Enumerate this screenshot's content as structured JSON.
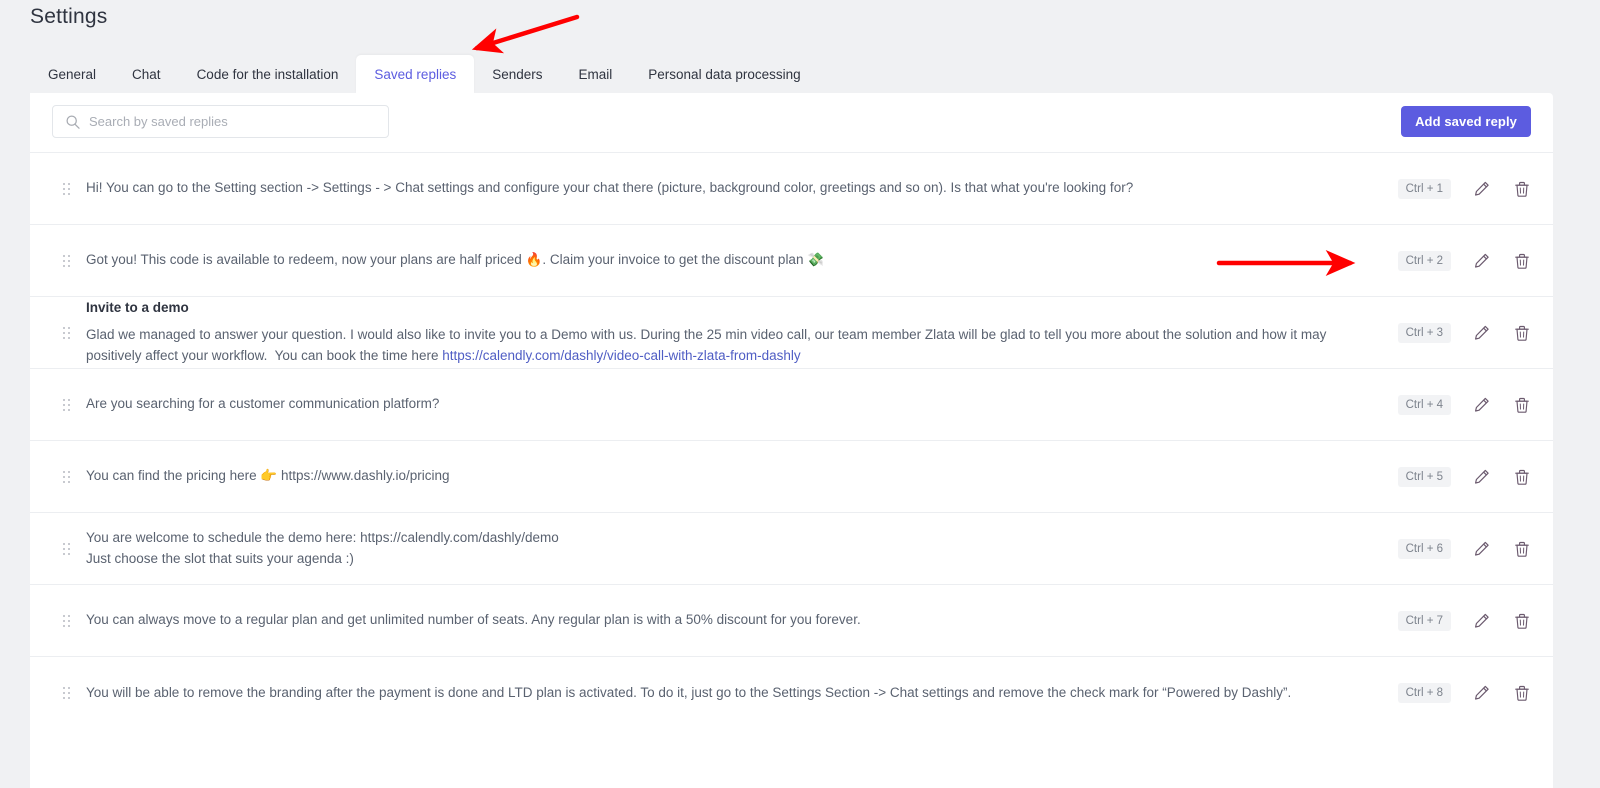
{
  "page": {
    "title": "Settings"
  },
  "tabs": [
    {
      "label": "General",
      "active": false
    },
    {
      "label": "Chat",
      "active": false
    },
    {
      "label": "Code for the installation",
      "active": false
    },
    {
      "label": "Saved replies",
      "active": true
    },
    {
      "label": "Senders",
      "active": false
    },
    {
      "label": "Email",
      "active": false
    },
    {
      "label": "Personal data processing",
      "active": false
    }
  ],
  "toolbar": {
    "search_placeholder": "Search by saved replies",
    "search_value": "",
    "search_icon": "search-icon",
    "add_button_label": "Add saved reply"
  },
  "rows": [
    {
      "heading": "",
      "text": "Hi! You can go to the Setting section -> Settings - > Chat settings and configure your chat there (picture, background color, greetings and so on). Is that what you're looking for?",
      "shortcut": "Ctrl + 1",
      "edit_icon": "pencil-icon",
      "delete_icon": "trash-icon",
      "drag_icon": "drag-handle-icon"
    },
    {
      "heading": "",
      "text": "Got you! This code is available to redeem, now your plans are half priced 🔥. Claim your invoice to get the discount plan 💸",
      "shortcut": "Ctrl + 2",
      "edit_icon": "pencil-icon",
      "delete_icon": "trash-icon",
      "drag_icon": "drag-handle-icon"
    },
    {
      "heading": "Invite to a demo",
      "text": "Glad we managed to answer your question. I would also like to invite you to a Demo with us. During the 25 min video call, our team member Zlata will be glad to tell you more about the solution and how it may positively affect your workflow.  You can book the time here https://calendly.com/dashly/video-call-with-zlata-from-dashly",
      "link": "https://calendly.com/dashly/video-call-with-zlata-from-dashly",
      "shortcut": "Ctrl + 3",
      "edit_icon": "pencil-icon",
      "delete_icon": "trash-icon",
      "drag_icon": "drag-handle-icon"
    },
    {
      "heading": "",
      "text": "Are you searching for a customer communication platform?",
      "shortcut": "Ctrl + 4",
      "edit_icon": "pencil-icon",
      "delete_icon": "trash-icon",
      "drag_icon": "drag-handle-icon"
    },
    {
      "heading": "",
      "text": "You can find the pricing here 👉 https://www.dashly.io/pricing",
      "shortcut": "Ctrl + 5",
      "edit_icon": "pencil-icon",
      "delete_icon": "trash-icon",
      "drag_icon": "drag-handle-icon"
    },
    {
      "heading": "",
      "text": "You are welcome to schedule the demo here: https://calendly.com/dashly/demo\nJust choose the slot that suits your agenda :)",
      "shortcut": "Ctrl + 6",
      "edit_icon": "pencil-icon",
      "delete_icon": "trash-icon",
      "drag_icon": "drag-handle-icon"
    },
    {
      "heading": "",
      "text": "You can always move to a regular plan and get unlimited number of seats. Any regular plan is with a 50% discount for you forever.",
      "shortcut": "Ctrl + 7",
      "edit_icon": "pencil-icon",
      "delete_icon": "trash-icon",
      "drag_icon": "drag-handle-icon"
    },
    {
      "heading": "",
      "text": "You will be able to remove the branding after the payment is done and LTD plan is activated. To do it, just go to the Settings Section -> Chat settings and remove the check mark for “Powered by Dashly”.",
      "shortcut": "Ctrl + 8",
      "edit_icon": "pencil-icon",
      "delete_icon": "trash-icon",
      "drag_icon": "drag-handle-icon"
    }
  ],
  "annotations": [
    {
      "name": "arrow-to-saved-replies-tab",
      "color": "#ff0000"
    },
    {
      "name": "arrow-to-ctrl-2-shortcut",
      "color": "#ff0000"
    }
  ],
  "colors": {
    "accent": "#5c5ce0",
    "tab_active_text": "#5c5ce0",
    "page_background": "#f0f1f3",
    "card_background": "#ffffff",
    "body_text": "#5a6270",
    "heading_text": "#2f3440",
    "annotation_red": "#ff0000",
    "shortcut_badge_bg": "#f2f3f5"
  }
}
